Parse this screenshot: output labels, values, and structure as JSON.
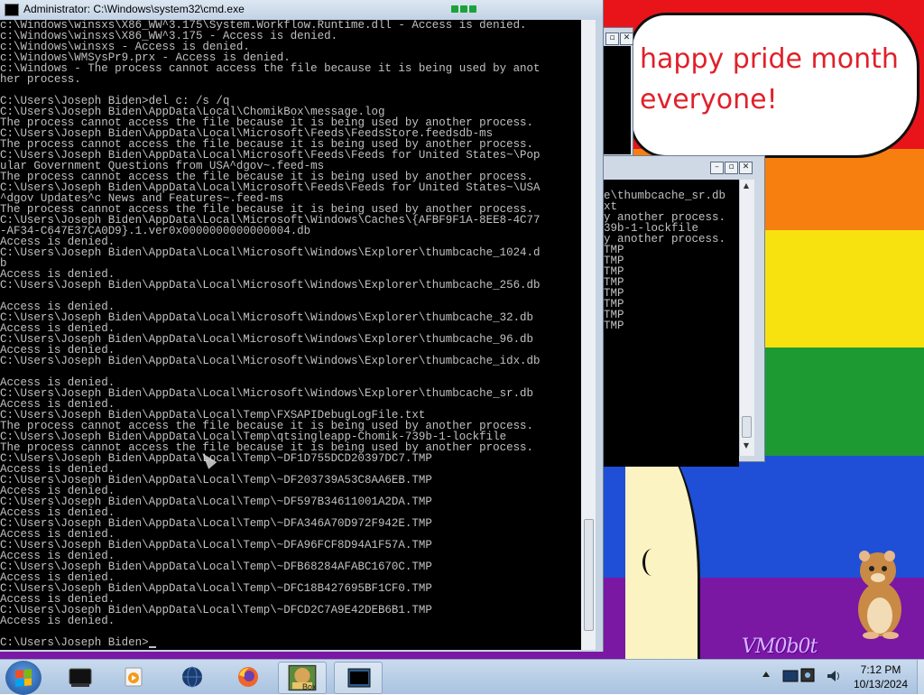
{
  "main_window": {
    "title": "Administrator: C:\\Windows\\system32\\cmd.exe",
    "prompt": "C:\\Users\\Joseph Biden>",
    "lines": [
      "c:\\Windows\\winsxs\\X86_WW^3.175\\System.Workflow.Runtime.dll - Access is denied.",
      "c:\\Windows\\winsxs\\X86_WW^3.175 - Access is denied.",
      "c:\\Windows\\winsxs - Access is denied.",
      "c:\\Windows\\WMSysPr9.prx - Access is denied.",
      "c:\\Windows - The process cannot access the file because it is being used by anot",
      "her process.",
      "",
      "C:\\Users\\Joseph Biden>del c: /s /q",
      "C:\\Users\\Joseph Biden\\AppData\\Local\\ChomikBox\\message.log",
      "The process cannot access the file because it is being used by another process.",
      "C:\\Users\\Joseph Biden\\AppData\\Local\\Microsoft\\Feeds\\FeedsStore.feedsdb-ms",
      "The process cannot access the file because it is being used by another process.",
      "C:\\Users\\Joseph Biden\\AppData\\Local\\Microsoft\\Feeds\\Feeds for United States~\\Pop",
      "ular Government Questions from USA^dgov~.feed-ms",
      "The process cannot access the file because it is being used by another process.",
      "C:\\Users\\Joseph Biden\\AppData\\Local\\Microsoft\\Feeds\\Feeds for United States~\\USA",
      "^dgov Updates^c News and Features~.feed-ms",
      "The process cannot access the file because it is being used by another process.",
      "C:\\Users\\Joseph Biden\\AppData\\Local\\Microsoft\\Windows\\Caches\\{AFBF9F1A-8EE8-4C77",
      "-AF34-C647E37CA0D9}.1.ver0x0000000000000004.db",
      "Access is denied.",
      "C:\\Users\\Joseph Biden\\AppData\\Local\\Microsoft\\Windows\\Explorer\\thumbcache_1024.d",
      "b",
      "Access is denied.",
      "C:\\Users\\Joseph Biden\\AppData\\Local\\Microsoft\\Windows\\Explorer\\thumbcache_256.db",
      "",
      "Access is denied.",
      "C:\\Users\\Joseph Biden\\AppData\\Local\\Microsoft\\Windows\\Explorer\\thumbcache_32.db",
      "Access is denied.",
      "C:\\Users\\Joseph Biden\\AppData\\Local\\Microsoft\\Windows\\Explorer\\thumbcache_96.db",
      "Access is denied.",
      "C:\\Users\\Joseph Biden\\AppData\\Local\\Microsoft\\Windows\\Explorer\\thumbcache_idx.db",
      "",
      "Access is denied.",
      "C:\\Users\\Joseph Biden\\AppData\\Local\\Microsoft\\Windows\\Explorer\\thumbcache_sr.db",
      "Access is denied.",
      "C:\\Users\\Joseph Biden\\AppData\\Local\\Temp\\FXSAPIDebugLogFile.txt",
      "The process cannot access the file because it is being used by another process.",
      "C:\\Users\\Joseph Biden\\AppData\\Local\\Temp\\qtsingleapp-Chomik-739b-1-lockfile",
      "The process cannot access the file because it is being used by another process.",
      "C:\\Users\\Joseph Biden\\AppData\\Local\\Temp\\~DF1D755DCD20397DC7.TMP",
      "Access is denied.",
      "C:\\Users\\Joseph Biden\\AppData\\Local\\Temp\\~DF203739A53C8AA6EB.TMP",
      "Access is denied.",
      "C:\\Users\\Joseph Biden\\AppData\\Local\\Temp\\~DF597B34611001A2DA.TMP",
      "Access is denied.",
      "C:\\Users\\Joseph Biden\\AppData\\Local\\Temp\\~DFA346A70D972F942E.TMP",
      "Access is denied.",
      "C:\\Users\\Joseph Biden\\AppData\\Local\\Temp\\~DFA96FCF8D94A1F57A.TMP",
      "Access is denied.",
      "C:\\Users\\Joseph Biden\\AppData\\Local\\Temp\\~DFB68284AFABC1670C.TMP",
      "Access is denied.",
      "C:\\Users\\Joseph Biden\\AppData\\Local\\Temp\\~DFC18B427695BF1CF0.TMP",
      "Access is denied.",
      "C:\\Users\\Joseph Biden\\AppData\\Local\\Temp\\~DFCD2C7A9E42DEB6B1.TMP",
      "Access is denied.",
      ""
    ]
  },
  "bg_window_1": {
    "lines": [
      "e\\thumbcache_sr.db",
      "",
      "xt",
      "y another process.",
      "39b-1-lockfile",
      "y another process.",
      "TMP",
      "",
      "TMP",
      "",
      "TMP",
      "",
      "TMP",
      "",
      "TMP",
      "",
      "TMP",
      "",
      "TMP",
      "",
      "TMP"
    ]
  },
  "wallpaper": {
    "bubble_text_1": "happy pride month",
    "bubble_text_2": "everyone!",
    "watermark": "VM0b0t"
  },
  "taskbar": {
    "items": [
      {
        "name": "terminal-icon"
      },
      {
        "name": "media-player-icon"
      },
      {
        "name": "globe-icon"
      },
      {
        "name": "firefox-icon"
      },
      {
        "name": "chomikbox-icon",
        "label": "Box"
      },
      {
        "name": "cmd-window-icon"
      }
    ],
    "time": "7:12 PM",
    "date": "10/13/2024"
  }
}
